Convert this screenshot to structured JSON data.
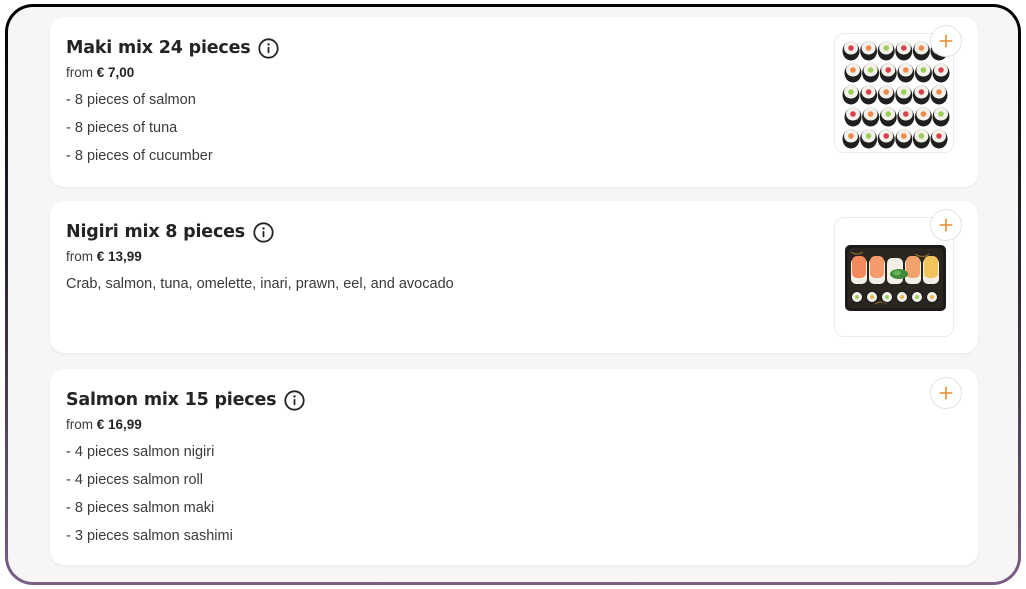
{
  "colors": {
    "accent": "#e08b2c",
    "text": "#242424",
    "card_bg": "#ffffff",
    "page_bg": "#f7f6f4"
  },
  "items": [
    {
      "title": "Maki mix 24 pieces",
      "price_prefix": "from",
      "price": "€ 7,00",
      "description": [
        "- 8 pieces of salmon",
        "- 8 pieces of tuna",
        "- 8 pieces of cucumber"
      ],
      "icons": {
        "info": "info-icon",
        "add": "plus-icon"
      },
      "has_image": true
    },
    {
      "title": "Nigiri mix 8 pieces",
      "price_prefix": "from",
      "price": "€ 13,99",
      "description": [
        "Crab, salmon, tuna, omelette, inari, prawn, eel, and avocado"
      ],
      "icons": {
        "info": "info-icon",
        "add": "plus-icon"
      },
      "has_image": true
    },
    {
      "title": "Salmon mix 15 pieces",
      "price_prefix": "from",
      "price": "€ 16,99",
      "description": [
        "- 4 pieces salmon nigiri",
        "- 4 pieces salmon roll",
        "- 8 pieces salmon maki",
        "- 3 pieces salmon sashimi"
      ],
      "icons": {
        "info": "info-icon",
        "add": "plus-icon"
      },
      "has_image": false
    }
  ]
}
